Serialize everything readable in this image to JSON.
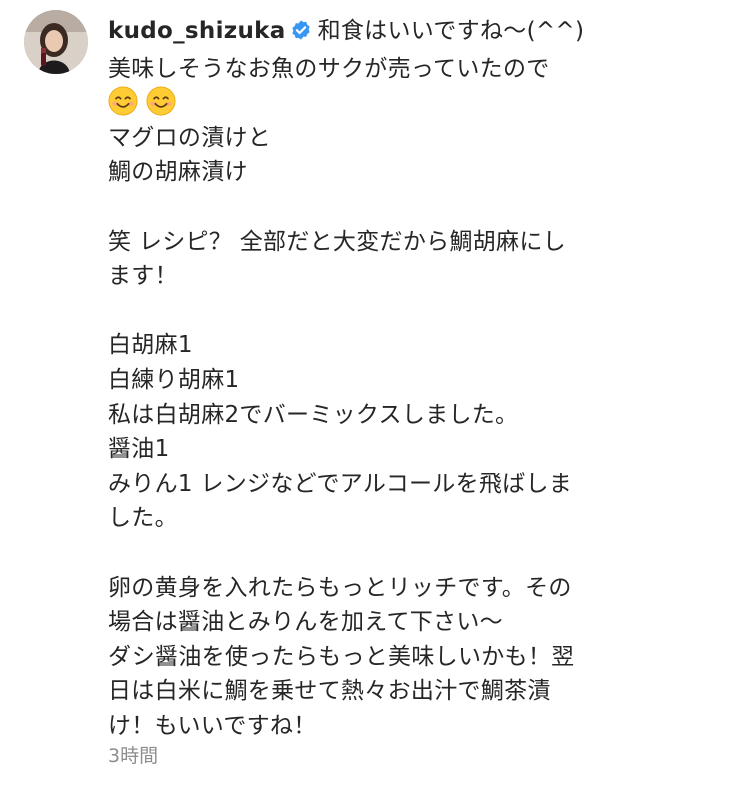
{
  "post": {
    "username": "kudo_shizuka",
    "first_line_text": "和食はいいですね〜(^^)",
    "verified_icon": "verified-badge-icon",
    "verified_color": "#3897f0",
    "emoji": [
      "smiling-face-icon",
      "smiling-face-icon"
    ],
    "lines": {
      "l1": "美味しそうなお魚のサクが売っていたので",
      "l3": "マグロの漬けと",
      "l4": "鯛の胡麻漬け",
      "l6": "笑 レシピ？  全部だと大変だから鯛胡麻にし",
      "l7": "ます！",
      "l9": "白胡麻1",
      "l10": "白練り胡麻1",
      "l11": "私は白胡麻2でバーミックスしました。",
      "l12": "醤油1",
      "l13": "みりん1  レンジなどでアルコールを飛ばしま",
      "l14": "した。",
      "l16": "卵の黄身を入れたらもっとリッチです。その",
      "l17": "場合は醤油とみりんを加えて下さい〜",
      "l18": "ダシ醤油を使ったらもっと美味しいかも！翌",
      "l19": "日は白米に鯛を乗せて熱々お出汁で鯛茶漬",
      "l20": "け！もいいですね！"
    },
    "timestamp": "3時間"
  }
}
